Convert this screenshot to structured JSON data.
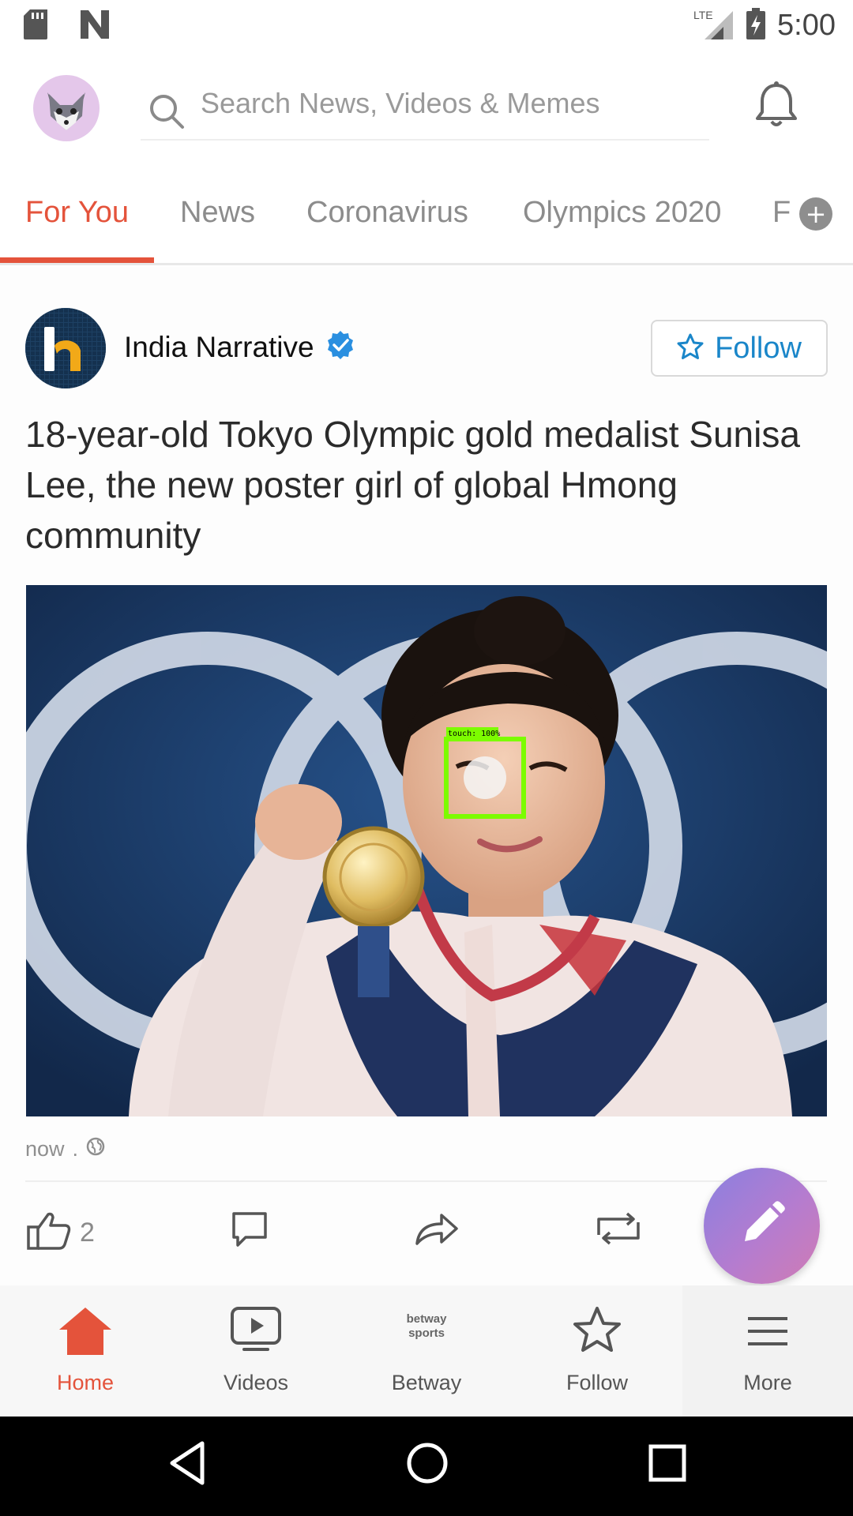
{
  "status_bar": {
    "time": "5:00",
    "network": "LTE",
    "icons": [
      "sd-card-icon",
      "n-notification-icon",
      "signal-icon",
      "battery-charging-icon"
    ]
  },
  "header": {
    "search_placeholder": "Search News, Videos & Memes",
    "icons": [
      "fox-avatar-icon",
      "search-icon",
      "bell-icon"
    ]
  },
  "tabs": {
    "items": [
      {
        "label": "For You",
        "active": true
      },
      {
        "label": "News",
        "active": false
      },
      {
        "label": "Coronavirus",
        "active": false
      },
      {
        "label": "Olympics 2020",
        "active": false
      },
      {
        "label": "F",
        "active": false
      }
    ],
    "add_label": "+"
  },
  "post": {
    "publisher": "India Narrative",
    "verified": true,
    "follow_label": "Follow",
    "headline": "18-year-old Tokyo Olympic gold medalist Sunisa Lee, the new poster girl of global Hmong community",
    "image_overlay_text": "touch: 100%",
    "timestamp": "now",
    "meta_separator": ".",
    "like_count": "2"
  },
  "bottom_nav": {
    "items": [
      {
        "label": "Home",
        "icon": "home-icon",
        "active": true
      },
      {
        "label": "Videos",
        "icon": "video-icon",
        "active": false
      },
      {
        "label": "Betway",
        "icon": "betway-sports-logo",
        "active": false
      },
      {
        "label": "Follow",
        "icon": "star-icon",
        "active": false
      },
      {
        "label": "More",
        "icon": "menu-icon",
        "active": false
      }
    ],
    "betway_logo_line1": "betway",
    "betway_logo_line2": "sports"
  },
  "colors": {
    "accent": "#e4533b",
    "follow_blue": "#1a86c9",
    "fab_gradient_start": "#8a80e0",
    "fab_gradient_end": "#d07bb4"
  }
}
